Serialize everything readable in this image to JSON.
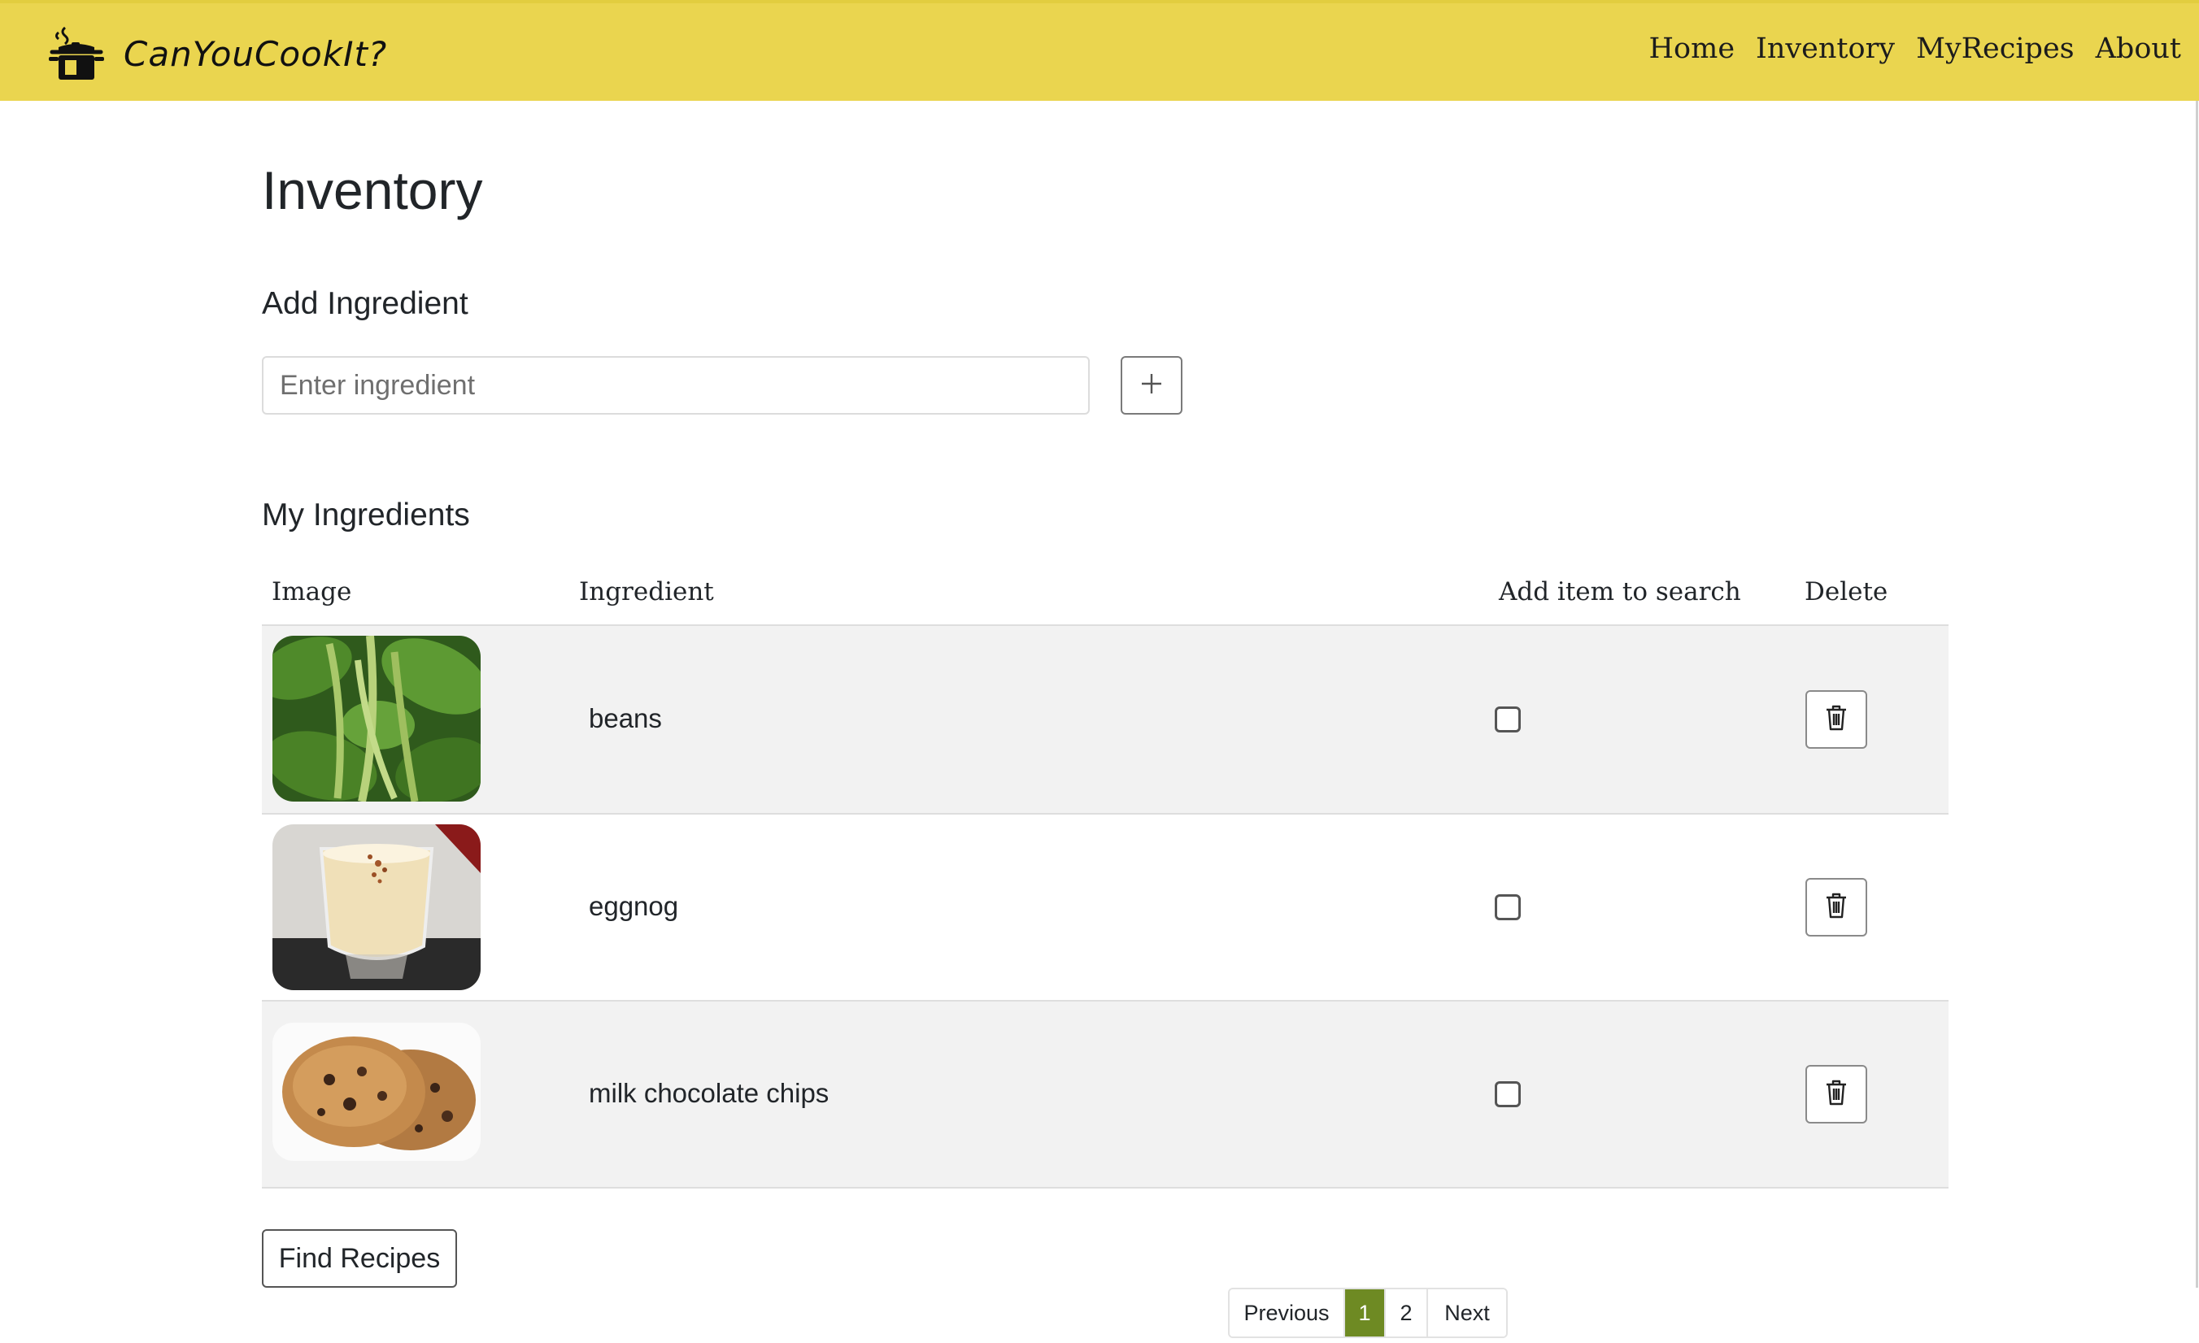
{
  "navbar": {
    "brand_name": "CanYouCookIt?",
    "logo_icon": "cooking-pot-icon",
    "links": [
      "Home",
      "Inventory",
      "MyRecipes",
      "About"
    ],
    "bg_color": "#ead54f"
  },
  "page": {
    "title": "Inventory",
    "add_section_title": "Add Ingredient",
    "input_placeholder": "Enter ingredient",
    "input_value": "",
    "add_button_icon": "plus-icon",
    "my_section_title": "My Ingredients"
  },
  "table": {
    "headers": [
      "Image",
      "Ingredient",
      "Add item to search",
      "Delete"
    ],
    "rows": [
      {
        "image": "green-beans-photo",
        "name": "beans",
        "checked": false,
        "delete_icon": "trash-icon"
      },
      {
        "image": "eggnog-glass-photo",
        "name": "eggnog",
        "checked": false,
        "delete_icon": "trash-icon"
      },
      {
        "image": "chocolate-chip-cookies-photo",
        "name": "milk chocolate chips",
        "checked": false,
        "delete_icon": "trash-icon"
      }
    ]
  },
  "actions": {
    "find_recipes_label": "Find Recipes"
  },
  "pagination": {
    "previous": "Previous",
    "pages": [
      "1",
      "2"
    ],
    "current_page": "1",
    "next": "Next",
    "active_color": "#6e8a23"
  }
}
